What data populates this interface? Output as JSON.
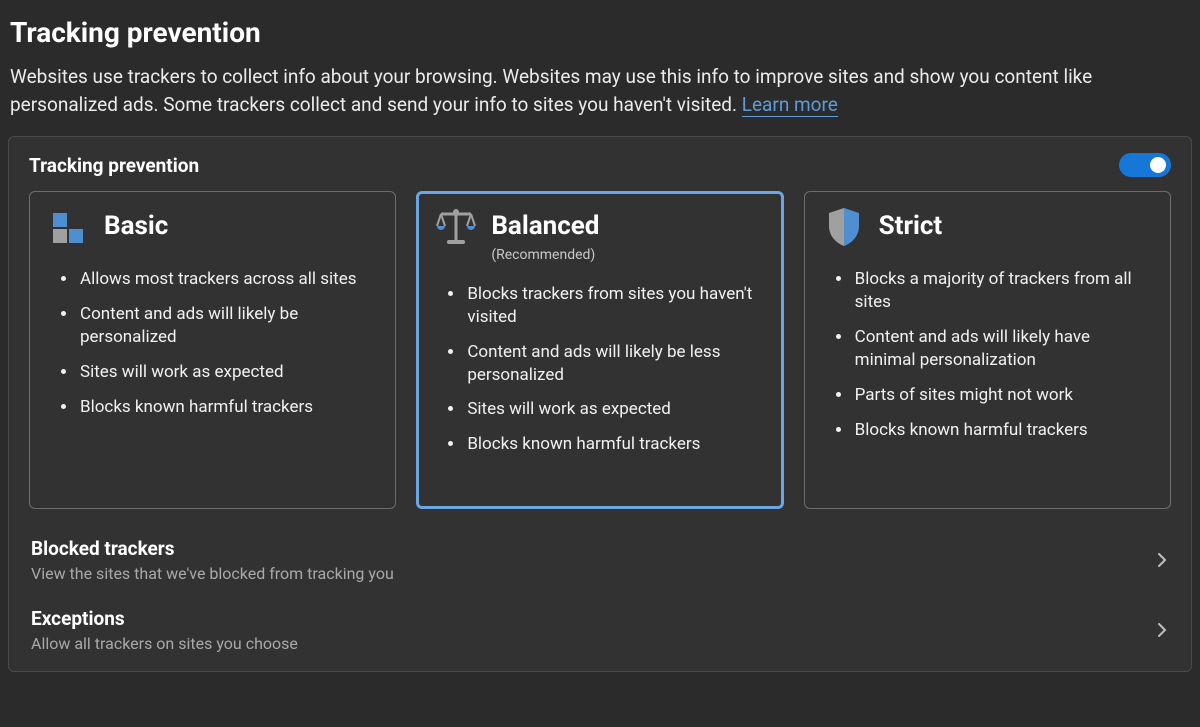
{
  "pageTitle": "Tracking prevention",
  "description": "Websites use trackers to collect info about your browsing. Websites may use this info to improve sites and show you content like personalized ads. Some trackers collect and send your info to sites you haven't visited. ",
  "learnMore": "Learn more",
  "panel": {
    "title": "Tracking prevention",
    "enabled": true
  },
  "cards": {
    "basic": {
      "title": "Basic",
      "subtitle": "",
      "bullet1": "Allows most trackers across all sites",
      "bullet2": "Content and ads will likely be personalized",
      "bullet3": "Sites will work as expected",
      "bullet4": "Blocks known harmful trackers"
    },
    "balanced": {
      "title": "Balanced",
      "subtitle": "(Recommended)",
      "bullet1": "Blocks trackers from sites you haven't visited",
      "bullet2": "Content and ads will likely be less personalized",
      "bullet3": "Sites will work as expected",
      "bullet4": "Blocks known harmful trackers"
    },
    "strict": {
      "title": "Strict",
      "subtitle": "",
      "bullet1": "Blocks a majority of trackers from all sites",
      "bullet2": "Content and ads will likely have minimal personalization",
      "bullet3": "Parts of sites might not work",
      "bullet4": "Blocks known harmful trackers"
    }
  },
  "rows": {
    "blocked": {
      "title": "Blocked trackers",
      "subtitle": "View the sites that we've blocked from tracking you"
    },
    "exceptions": {
      "title": "Exceptions",
      "subtitle": "Allow all trackers on sites you choose"
    }
  },
  "colors": {
    "accent": "#5b98d6",
    "toggle": "#1677d6",
    "cardSelected": "#6aa6e4",
    "bgPanel": "#323232",
    "bgPage": "#2b2b2b"
  }
}
